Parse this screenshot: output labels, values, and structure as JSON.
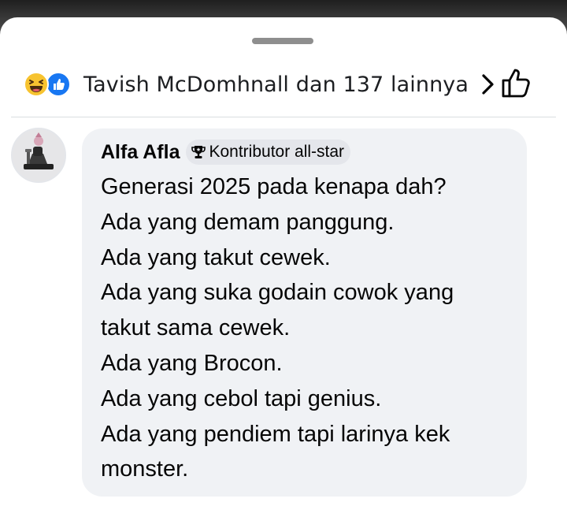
{
  "reactions": {
    "icons": [
      "haha-icon",
      "like-icon"
    ],
    "summary": "Tavish McDomhnall dan 137 lainnya",
    "colors": {
      "haha": "#f7c330",
      "like": "#1877f2"
    }
  },
  "comment": {
    "author": "Alfa Afla",
    "badge": "Kontributor all-star",
    "lines": [
      "Generasi 2025 pada kenapa dah?",
      "Ada yang demam panggung.",
      "Ada yang takut cewek.",
      "Ada yang suka godain cowok yang",
      "takut sama cewek.",
      "Ada yang Brocon.",
      "Ada yang cebol tapi genius.",
      "Ada yang pendiem tapi larinya kek",
      "monster."
    ]
  }
}
